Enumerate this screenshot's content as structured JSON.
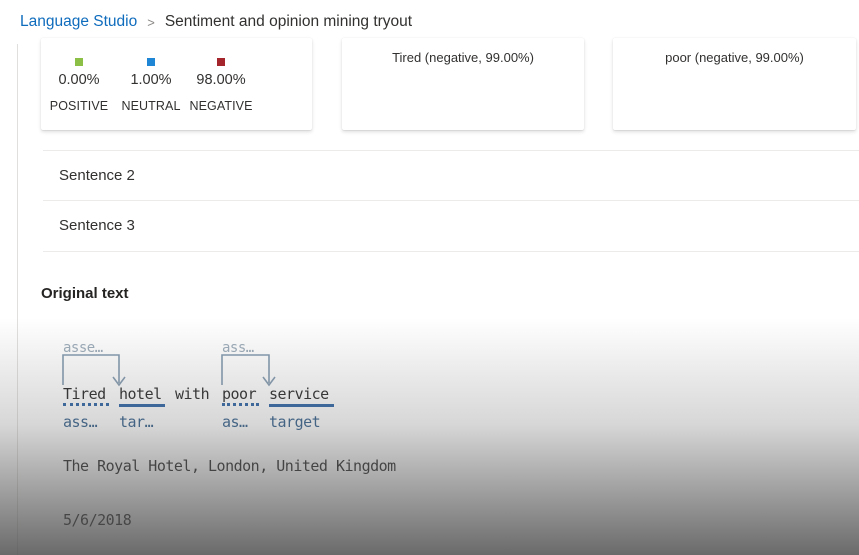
{
  "breadcrumb": {
    "root": "Language Studio",
    "separator": ">",
    "current": "Sentiment and opinion mining tryout"
  },
  "scores": [
    {
      "percent": "0.00%",
      "label": "POSITIVE",
      "color": "#8cbf45"
    },
    {
      "percent": "1.00%",
      "label": "NEUTRAL",
      "color": "#1f86d6"
    },
    {
      "percent": "98.00%",
      "label": "NEGATIVE",
      "color": "#a4262c"
    }
  ],
  "assessments": [
    {
      "text": "Tired (negative, 99.00%)"
    },
    {
      "text": "poor (negative, 99.00%)"
    }
  ],
  "sentences": [
    {
      "label": "Sentence 2"
    },
    {
      "label": "Sentence 3"
    }
  ],
  "original_text": {
    "title": "Original text",
    "top_labels": [
      "asse…",
      "ass…"
    ],
    "tokens": [
      "Tired",
      "hotel",
      "with",
      "poor",
      "service"
    ],
    "bottom_labels": [
      "ass…",
      "tar…",
      "as…",
      "target"
    ],
    "lines": [
      "The Royal Hotel, London, United Kingdom",
      "5/6/2018"
    ]
  },
  "colors": {
    "link": "#0f6cbd",
    "annotation": "#1f5aa0"
  }
}
